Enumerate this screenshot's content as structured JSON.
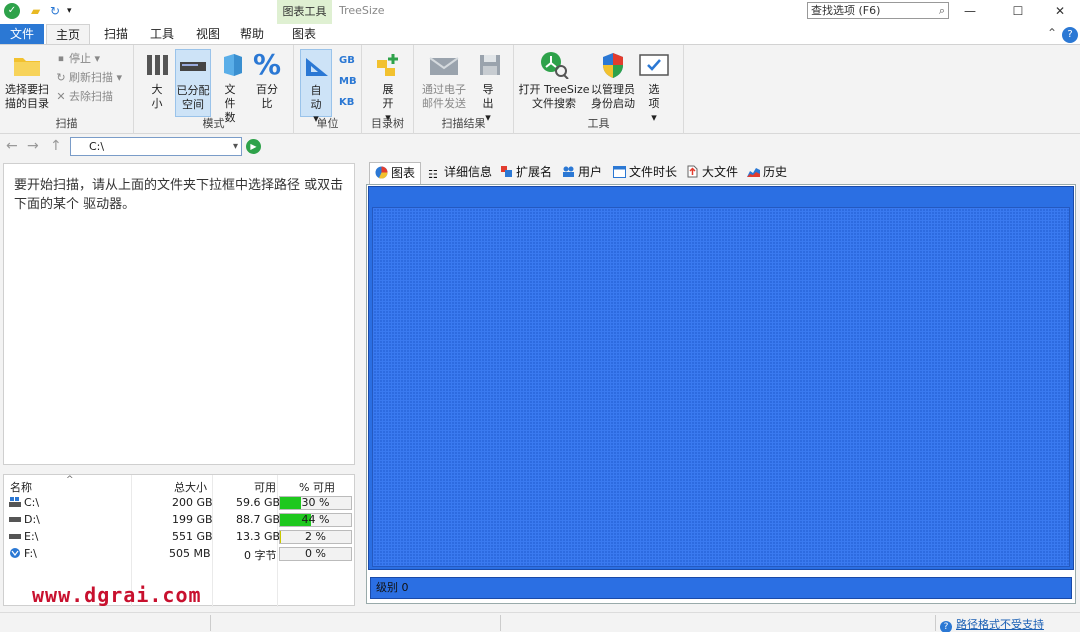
{
  "titlebar": {
    "context_tab": "图表工具",
    "window_title": "TreeSize",
    "search_placeholder": "查找选项 (F6)"
  },
  "tabs": {
    "file": "文件",
    "home": "主页",
    "scan": "扫描",
    "tools": "工具",
    "view": "视图",
    "help": "帮助",
    "chart": "图表"
  },
  "ribbon": {
    "scan_group": {
      "label": "扫描",
      "select_dir": "选择要扫描的目录",
      "stop": "停止",
      "refresh": "刷新扫描",
      "remove": "去除扫描"
    },
    "mode_group": {
      "label": "模式",
      "size": "大小",
      "allocated": "已分配空间",
      "file_count": "文件数",
      "percent": "百分比"
    },
    "unit_group": {
      "label": "单位",
      "auto": "自动",
      "gb": "GB",
      "mb": "MB",
      "kb": "KB"
    },
    "tree_group": {
      "label": "目录树",
      "expand": "展开"
    },
    "results_group": {
      "label": "扫描结果",
      "email": "通过电子邮件发送",
      "export": "导出"
    },
    "tools_group": {
      "label": "工具",
      "open_search": "打开 TreeSize 文件搜索",
      "admin": "以管理员身份启动",
      "options": "选项"
    }
  },
  "nav": {
    "path": "C:\\"
  },
  "message": "要开始扫描，请从上面的文件夹下拉框中选择路径 或双击下面的某个 驱动器。",
  "drives": {
    "headers": {
      "name": "名称",
      "total": "总大小",
      "free": "可用",
      "pct_free": "% 可用"
    },
    "rows": [
      {
        "name": "C:\\",
        "total": "200 GB",
        "free": "59.6 GB",
        "pct_label": "30 %",
        "pct": 30
      },
      {
        "name": "D:\\",
        "total": "199 GB",
        "free": "88.7 GB",
        "pct_label": "44 %",
        "pct": 44
      },
      {
        "name": "E:\\",
        "total": "551 GB",
        "free": "13.3 GB",
        "pct_label": "2 %",
        "pct": 2
      },
      {
        "name": "F:\\",
        "total": "505 MB",
        "free": "0 字节",
        "pct_label": "0 %",
        "pct": 0
      }
    ]
  },
  "view_tabs": {
    "chart": "图表",
    "details": "详细信息",
    "extensions": "扩展名",
    "users": "用户",
    "age": "文件时长",
    "top_files": "大文件",
    "history": "历史"
  },
  "chart": {
    "level": "级别 0"
  },
  "status": {
    "warning": "路径格式不受支持"
  },
  "watermark": "www.dgrai.com"
}
